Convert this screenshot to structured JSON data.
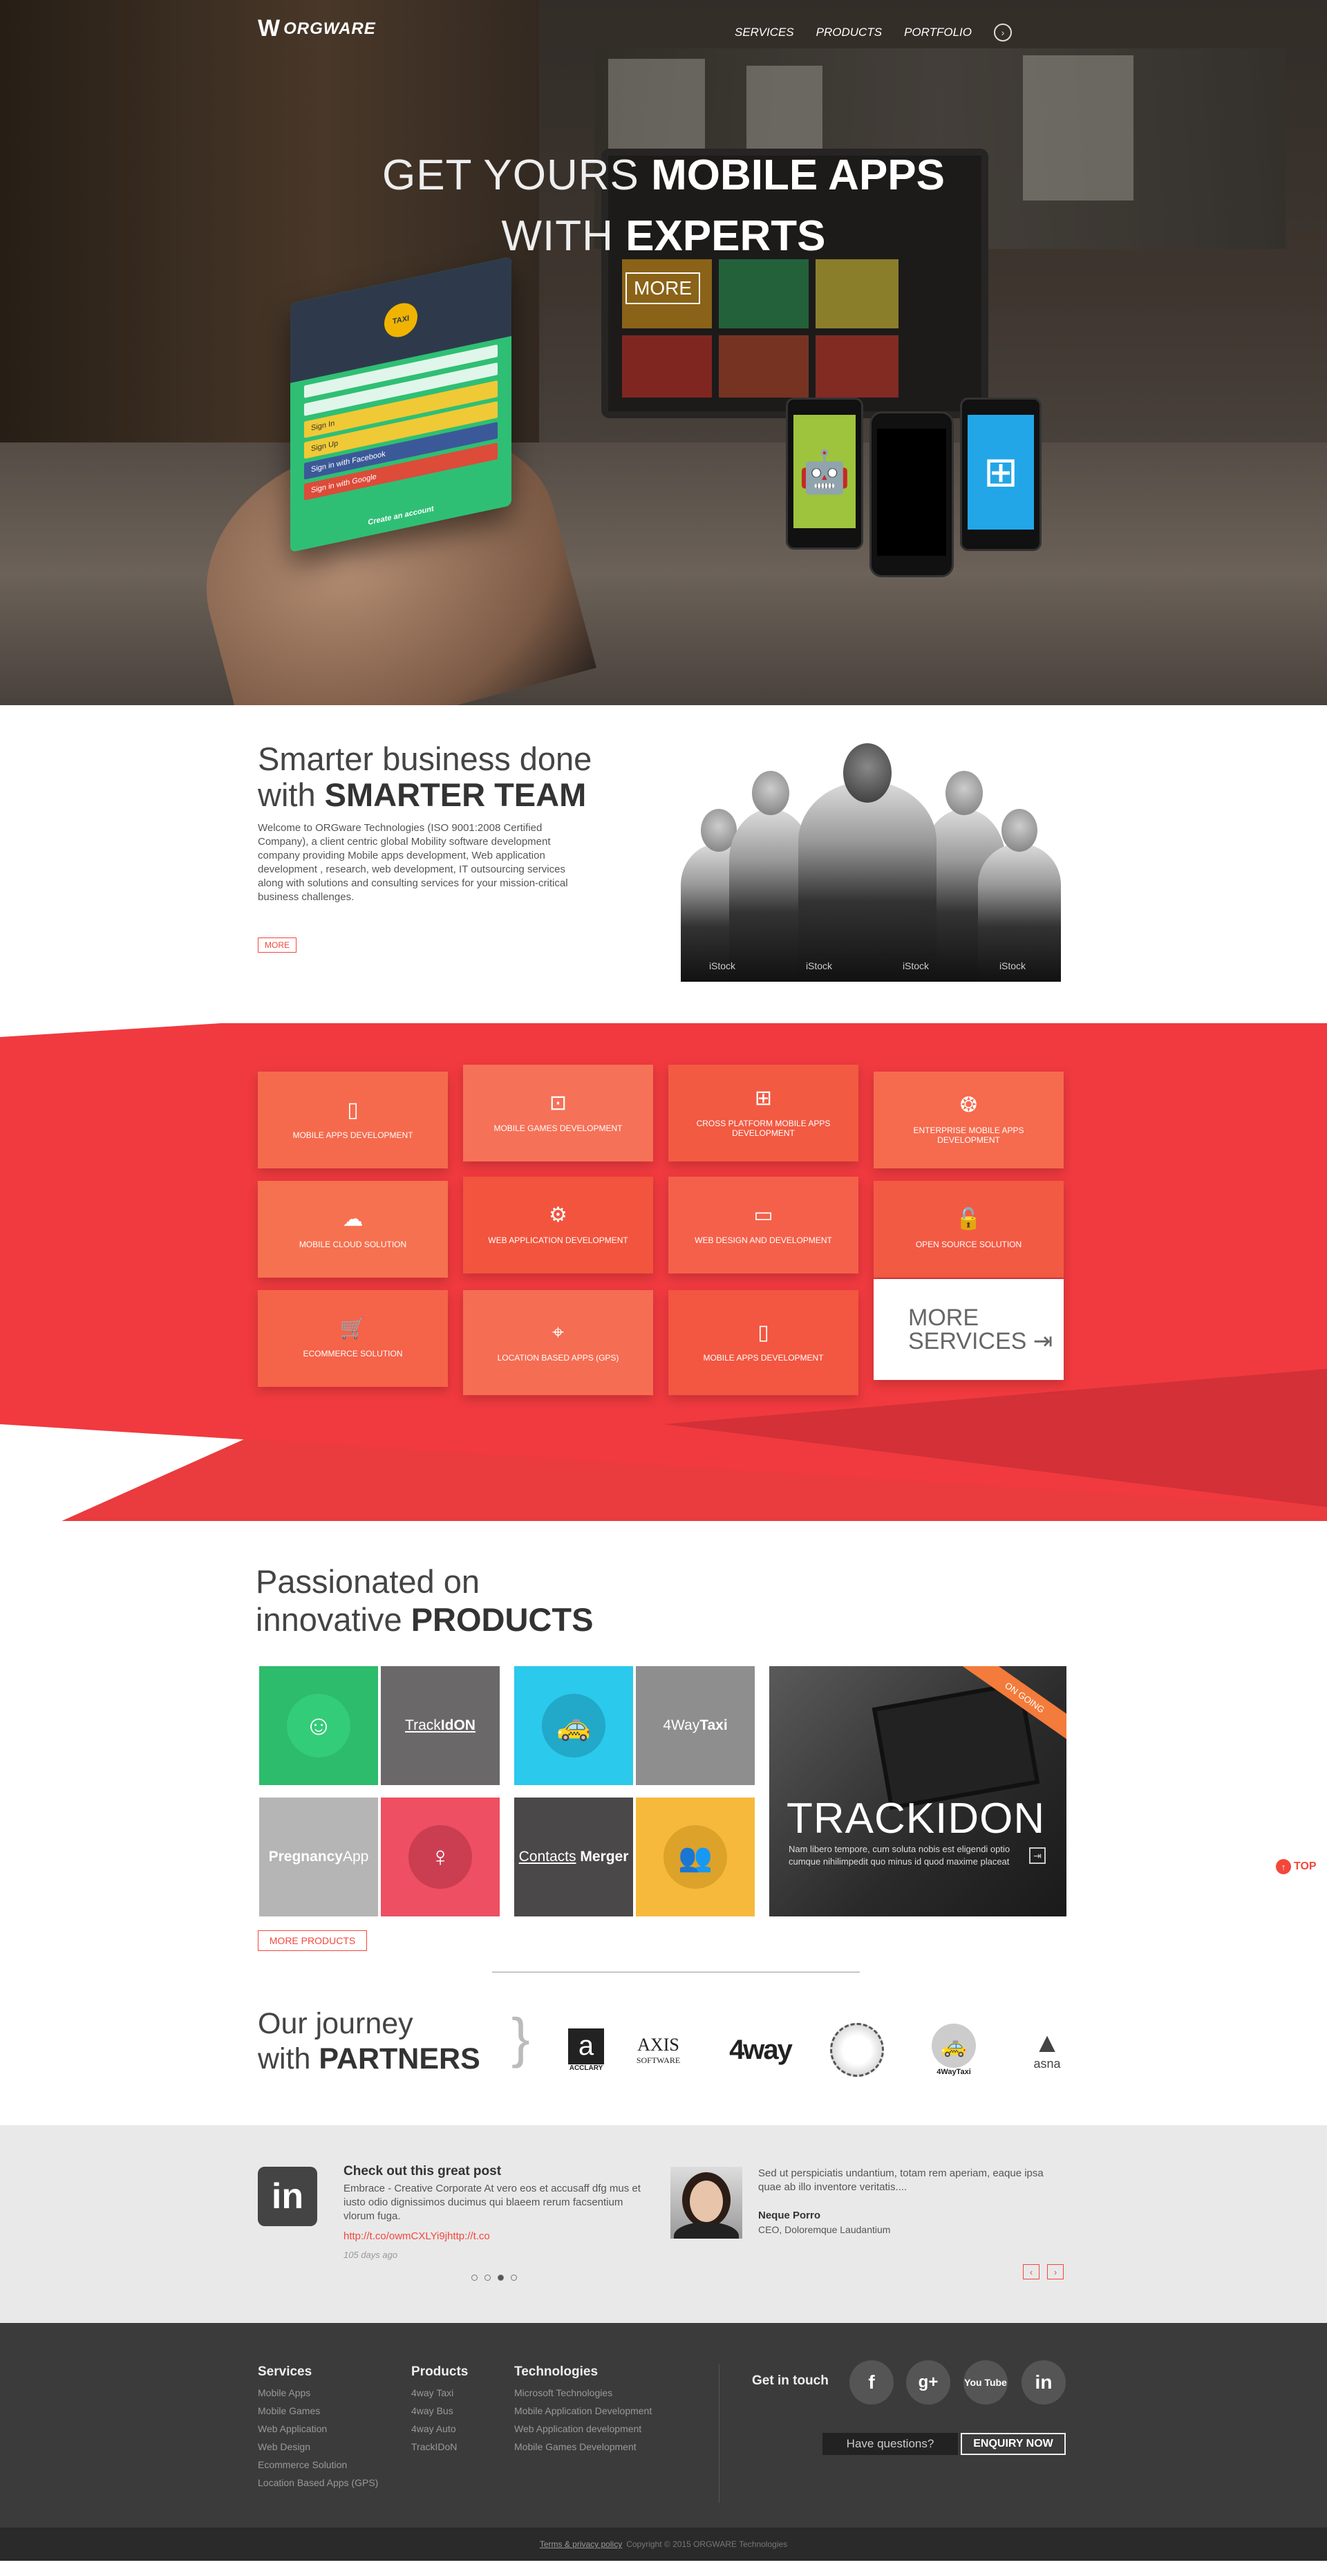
{
  "header": {
    "logo_text": "ORGWARE",
    "logo_mark": "W",
    "nav": [
      "SERVICES",
      "PRODUCTS",
      "PORTFOLIO"
    ]
  },
  "hero": {
    "line1_light": "GET YOURS",
    "line1_bold": "MOBILE APPS",
    "line2_light": "WITH",
    "line2_bold": "EXPERTS",
    "more_label": "MORE",
    "app_buttons": [
      "Sign In",
      "Sign Up",
      "Sign in with Facebook",
      "Sign in with Google"
    ],
    "app_footer": "Create an account"
  },
  "about": {
    "title_light_1": "Smarter business done",
    "title_light_2": "with",
    "title_bold": "SMARTER TEAM",
    "body": "Welcome to ORGware Technologies (ISO 9001:2008 Certified Company), a client centric global Mobility software development company providing Mobile apps development, Web application development , research, web development, IT outsourcing services along with solutions and consulting services for your mission-critical business challenges.",
    "more_label": "MORE",
    "watermark": "iStock"
  },
  "services": {
    "items": [
      {
        "label": "MOBILE APPS DEVELOPMENT",
        "icon": "smartphone-icon",
        "glyph": "▯"
      },
      {
        "label": "MOBILE GAMES DEVELOPMENT",
        "icon": "gamepad-icon",
        "glyph": "⊡"
      },
      {
        "label": "CROSS PLATFORM MOBILE APPS DEVELOPMENT",
        "icon": "platforms-icon",
        "glyph": "  ⊞ "
      },
      {
        "label": "ENTERPRISE MOBILE APPS DEVELOPMENT",
        "icon": "network-icon",
        "glyph": "❂"
      },
      {
        "label": "MOBILE CLOUD SOLUTION",
        "icon": "cloud-icon",
        "glyph": "☁"
      },
      {
        "label": "WEB APPLICATION DEVELOPMENT",
        "icon": "web-app-icon",
        "glyph": "⚙"
      },
      {
        "label": "WEB DESIGN AND DEVELOPMENT",
        "icon": "monitor-icon",
        "glyph": "▭"
      },
      {
        "label": "OPEN SOURCE SOLUTION",
        "icon": "lock-icon",
        "glyph": "🔓"
      },
      {
        "label": "ECOMMERCE SOLUTION",
        "icon": "cart-icon",
        "glyph": "🛒"
      },
      {
        "label": "LOCATION BASED APPS (GPS)",
        "icon": "location-icon",
        "glyph": "⌖"
      },
      {
        "label": "MOBILE APPS DEVELOPMENT",
        "icon": "smartphone-icon",
        "glyph": "▯"
      }
    ],
    "more_line1": "MORE",
    "more_line2": "SERVICES"
  },
  "products": {
    "title_light_1": "Passionated on",
    "title_light_2": "innovative",
    "title_bold": "PRODUCTS",
    "tiles": {
      "trackidon_light": "Track",
      "trackidon_bold": "IdON",
      "fourway_light": "4Way",
      "fourway_bold": "Taxi",
      "pregnancy_bold": "Pregnancy",
      "pregnancy_light": "App",
      "contacts_light": "Contacts",
      "contacts_bold": "Merger"
    },
    "feature": {
      "ribbon": "ON GOING",
      "name": "TRACKIDON",
      "desc": "Nam libero tempore, cum soluta nobis est eligendi optio cumque nihilimpedit quo minus id quod maxime placeat"
    },
    "more_label": "MORE PRODUCTS",
    "top_label": "TOP"
  },
  "partners": {
    "title_light_1": "Our journey",
    "title_light_2": "with",
    "title_bold": "PARTNERS",
    "logos": [
      {
        "name": "ACCLARY",
        "mark": "a"
      },
      {
        "name": "AXIS",
        "sub": "SOFTWARE"
      },
      {
        "name": "4way"
      },
      {
        "name": "seal"
      },
      {
        "name": "4WayTaxi"
      },
      {
        "name": "asna"
      }
    ]
  },
  "testimonial": {
    "post_title": "Check out this great post",
    "post_body": "Embrace - Creative Corporate At vero eos et accusaff dfg mus et iusto odio dignissimos ducimus qui blaeem rerum facsentium vlorum fuga.",
    "post_link": "http://t.co/owmCXLYi9jhttp://t.co",
    "post_time": "105 days ago",
    "quote": "Sed ut perspiciatis undantium, totam rem aperiam, eaque ipsa quae ab illo inventore veritatis....",
    "name": "Neque Porro",
    "role": "CEO, Doloremque Laudantium"
  },
  "footer": {
    "columns": [
      {
        "title": "Services",
        "items": [
          "Mobile Apps",
          "Mobile Games",
          "Web Application",
          "Web Design",
          "Ecommerce Solution",
          "Location Based Apps (GPS)"
        ]
      },
      {
        "title": "Products",
        "items": [
          "4way Taxi",
          "4way Bus",
          "4way Auto",
          "TrackIDoN"
        ]
      },
      {
        "title": "Technologies",
        "items": [
          "Microsoft Technologies",
          "Mobile Application Development",
          "Web Application development",
          "Mobile Games Development"
        ]
      }
    ],
    "get_in_touch": "Get in touch",
    "social": [
      "f",
      "g+",
      "You Tube",
      "in"
    ],
    "have_questions": "Have questions?",
    "enquiry": "ENQUIRY NOW",
    "terms": "Terms & privacy policy",
    "copyright": "Copyright © 2015 ORGWARE Technologies"
  },
  "colors": {
    "accent": "#f3473c",
    "tile": "#f6664a",
    "dark": "#3b3b3b"
  }
}
